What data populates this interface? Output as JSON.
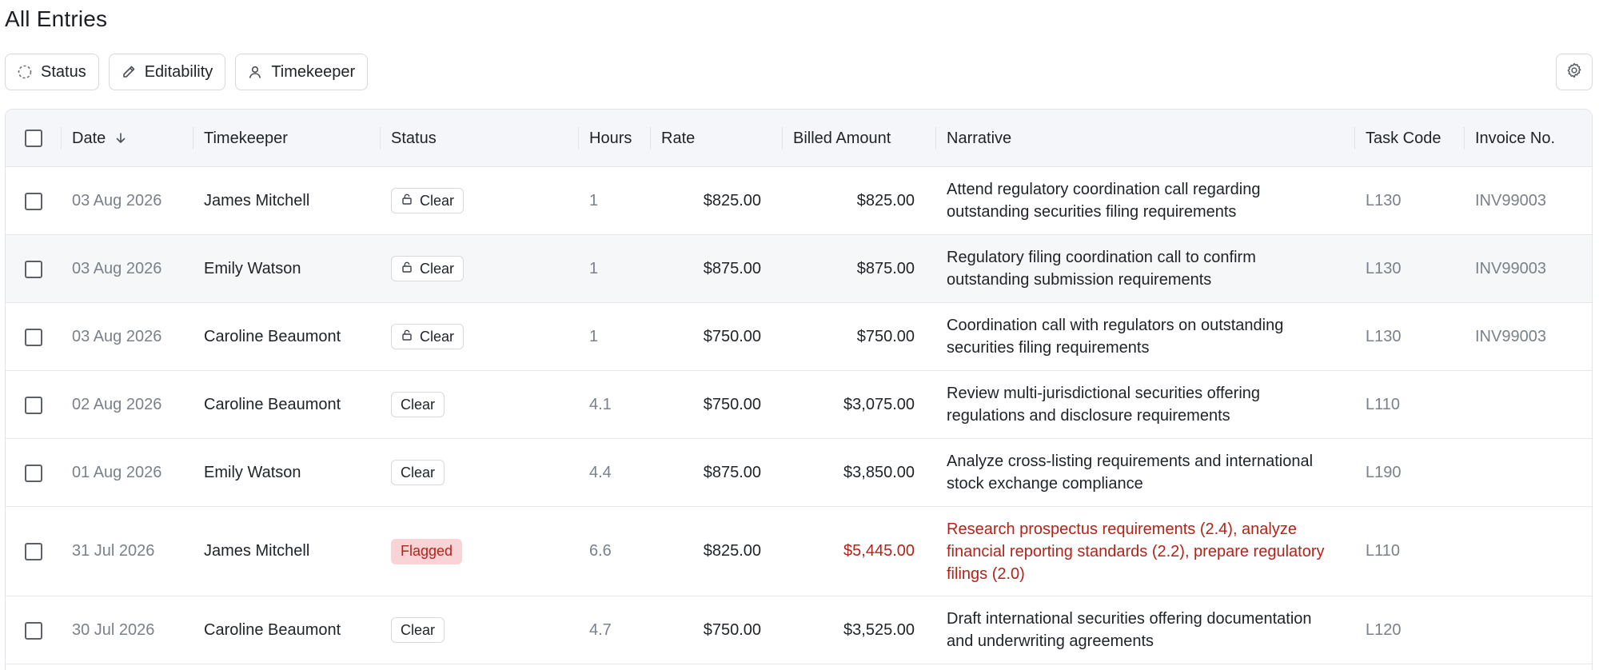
{
  "page": {
    "title": "All Entries"
  },
  "filters": [
    {
      "label": "Status",
      "icon": "dashed-circle-icon"
    },
    {
      "label": "Editability",
      "icon": "pencil-icon"
    },
    {
      "label": "Timekeeper",
      "icon": "user-icon"
    }
  ],
  "settings": {
    "icon": "gear-icon"
  },
  "columns": {
    "date": "Date",
    "timekeeper": "Timekeeper",
    "status": "Status",
    "hours": "Hours",
    "rate": "Rate",
    "billed": "Billed Amount",
    "narrative": "Narrative",
    "task_code": "Task Code",
    "invoice": "Invoice No."
  },
  "rows": [
    {
      "date": "03 Aug 2026",
      "timekeeper": "James Mitchell",
      "status": "Clear",
      "locked": true,
      "hours": "1",
      "rate": "$825.00",
      "billed": "$825.00",
      "narrative": "Attend regulatory coordination call regarding outstanding securities filing requirements",
      "task_code": "L130",
      "invoice": "INV99003"
    },
    {
      "date": "03 Aug 2026",
      "timekeeper": "Emily Watson",
      "status": "Clear",
      "locked": true,
      "hours": "1",
      "rate": "$875.00",
      "billed": "$875.00",
      "narrative": "Regulatory filing coordination call to confirm outstanding submission requirements",
      "task_code": "L130",
      "invoice": "INV99003"
    },
    {
      "date": "03 Aug 2026",
      "timekeeper": "Caroline Beaumont",
      "status": "Clear",
      "locked": true,
      "hours": "1",
      "rate": "$750.00",
      "billed": "$750.00",
      "narrative": "Coordination call with regulators on outstanding securities filing requirements",
      "task_code": "L130",
      "invoice": "INV99003"
    },
    {
      "date": "02 Aug 2026",
      "timekeeper": "Caroline Beaumont",
      "status": "Clear",
      "locked": false,
      "hours": "4.1",
      "rate": "$750.00",
      "billed": "$3,075.00",
      "narrative": "Review multi-jurisdictional securities offering regulations and disclosure requirements",
      "task_code": "L110",
      "invoice": ""
    },
    {
      "date": "01 Aug 2026",
      "timekeeper": "Emily Watson",
      "status": "Clear",
      "locked": false,
      "hours": "4.4",
      "rate": "$875.00",
      "billed": "$3,850.00",
      "narrative": "Analyze cross-listing requirements and international stock exchange compliance",
      "task_code": "L190",
      "invoice": ""
    },
    {
      "date": "31 Jul 2026",
      "timekeeper": "James Mitchell",
      "status": "Flagged",
      "locked": false,
      "hours": "6.6",
      "rate": "$825.00",
      "billed": "$5,445.00",
      "narrative": "Research prospectus requirements (2.4), analyze financial reporting standards (2.2), prepare regulatory filings (2.0)",
      "task_code": "L110",
      "invoice": ""
    },
    {
      "date": "30 Jul 2026",
      "timekeeper": "Caroline Beaumont",
      "status": "Clear",
      "locked": false,
      "hours": "4.7",
      "rate": "$750.00",
      "billed": "$3,525.00",
      "narrative": "Draft international securities offering documentation and underwriting agreements",
      "task_code": "L120",
      "invoice": ""
    }
  ],
  "colors": {
    "flagged_text": "#b42318",
    "flagged_bg": "#f9d3d6",
    "header_bg": "#f4f6f9",
    "hover_row": "#f6f7f9"
  }
}
